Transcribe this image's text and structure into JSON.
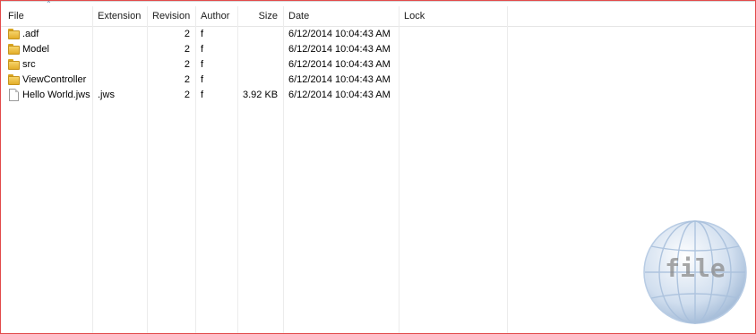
{
  "columns": {
    "file": "File",
    "extension": "Extension",
    "revision": "Revision",
    "author": "Author",
    "size": "Size",
    "date": "Date",
    "lock": "Lock"
  },
  "rows": [
    {
      "icon": "folder-icon",
      "file": ".adf",
      "extension": "",
      "revision": "2",
      "author": "f",
      "size": "",
      "date": "6/12/2014 10:04:43 AM",
      "lock": ""
    },
    {
      "icon": "folder-icon",
      "file": "Model",
      "extension": "",
      "revision": "2",
      "author": "f",
      "size": "",
      "date": "6/12/2014 10:04:43 AM",
      "lock": ""
    },
    {
      "icon": "folder-icon",
      "file": "src",
      "extension": "",
      "revision": "2",
      "author": "f",
      "size": "",
      "date": "6/12/2014 10:04:43 AM",
      "lock": ""
    },
    {
      "icon": "folder-icon",
      "file": "ViewController",
      "extension": "",
      "revision": "2",
      "author": "f",
      "size": "",
      "date": "6/12/2014 10:04:43 AM",
      "lock": ""
    },
    {
      "icon": "file-icon",
      "file": "Hello World.jws",
      "extension": ".jws",
      "revision": "2",
      "author": "f",
      "size": "3.92 KB",
      "date": "6/12/2014 10:04:43 AM",
      "lock": ""
    }
  ],
  "watermark": {
    "text": "file"
  },
  "colors": {
    "border": "#e24a4a",
    "folder": "#e3ae2a",
    "globe": "#b8cce4"
  }
}
